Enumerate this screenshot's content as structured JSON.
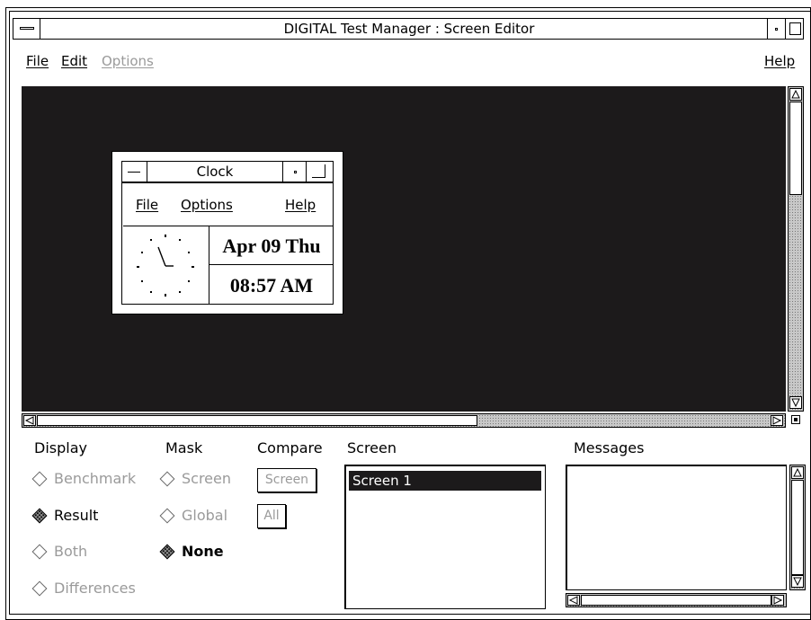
{
  "window": {
    "title": "DIGITAL Test Manager : Screen Editor"
  },
  "menubar": {
    "items": [
      "File",
      "Edit",
      "Options"
    ],
    "help": "Help"
  },
  "clock_window": {
    "title": "Clock",
    "menu": {
      "file": "File",
      "options": "Options",
      "help": "Help"
    },
    "date": "Apr 09 Thu",
    "time": "08:57 AM"
  },
  "display": {
    "heading": "Display",
    "options": [
      {
        "label": "Benchmark",
        "enabled": false,
        "selected": false
      },
      {
        "label": "Result",
        "enabled": true,
        "selected": true
      },
      {
        "label": "Both",
        "enabled": false,
        "selected": false
      },
      {
        "label": "Differences",
        "enabled": false,
        "selected": false
      }
    ]
  },
  "mask": {
    "heading": "Mask",
    "options": [
      {
        "label": "Screen",
        "enabled": false,
        "selected": false
      },
      {
        "label": "Global",
        "enabled": false,
        "selected": false
      },
      {
        "label": "None",
        "enabled": true,
        "selected": true
      }
    ]
  },
  "compare": {
    "heading": "Compare",
    "buttons": [
      "Screen",
      "All"
    ]
  },
  "screen_list": {
    "heading": "Screen",
    "items": [
      "Screen 1"
    ],
    "selected_index": 0
  },
  "messages": {
    "heading": "Messages"
  }
}
